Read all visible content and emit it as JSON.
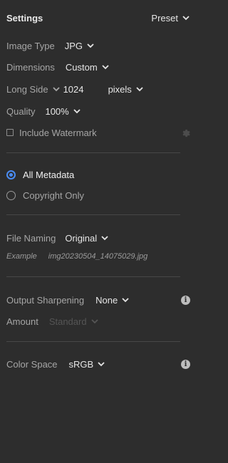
{
  "header": {
    "title": "Settings",
    "preset_label": "Preset"
  },
  "image_type": {
    "label": "Image Type",
    "value": "JPG"
  },
  "dimensions": {
    "label": "Dimensions",
    "value": "Custom"
  },
  "long_side": {
    "label": "Long Side",
    "value": "1024",
    "unit": "pixels"
  },
  "quality": {
    "label": "Quality",
    "value": "100%"
  },
  "watermark": {
    "label": "Include Watermark",
    "checked": false
  },
  "metadata": {
    "options": [
      {
        "label": "All Metadata",
        "selected": true
      },
      {
        "label": "Copyright Only",
        "selected": false
      }
    ]
  },
  "file_naming": {
    "label": "File Naming",
    "value": "Original",
    "example_label": "Example",
    "example_value": "img20230504_14075029.jpg"
  },
  "output_sharpening": {
    "label": "Output Sharpening",
    "value": "None"
  },
  "amount": {
    "label": "Amount",
    "value": "Standard"
  },
  "color_space": {
    "label": "Color Space",
    "value": "sRGB"
  },
  "colors": {
    "accent": "#4a8cf2",
    "background": "#2d2d2d"
  }
}
